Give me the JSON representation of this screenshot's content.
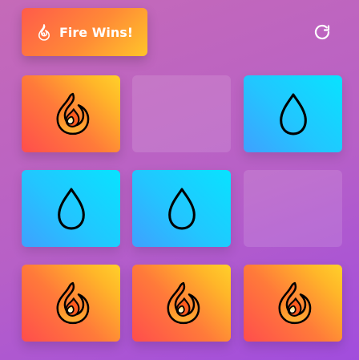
{
  "header": {
    "status": {
      "icon": "flame-icon",
      "text": "Fire Wins!",
      "gradient": [
        "#ff5b4a",
        "#ff8a36",
        "#ffc52a"
      ]
    },
    "reset_icon": "reset-icon"
  },
  "board": {
    "rows": [
      [
        "fire",
        "empty",
        "water"
      ],
      [
        "water",
        "water",
        "empty"
      ],
      [
        "fire",
        "fire",
        "fire"
      ]
    ]
  },
  "colors": {
    "background_from": "#c56ab8",
    "background_to": "#a14ddd",
    "fire_from": "#ff4d4d",
    "fire_to": "#ffd02a",
    "water_from": "#3fa0ff",
    "water_to": "#08e3ff",
    "empty_cell": "rgba(255,255,255,0.12)"
  }
}
